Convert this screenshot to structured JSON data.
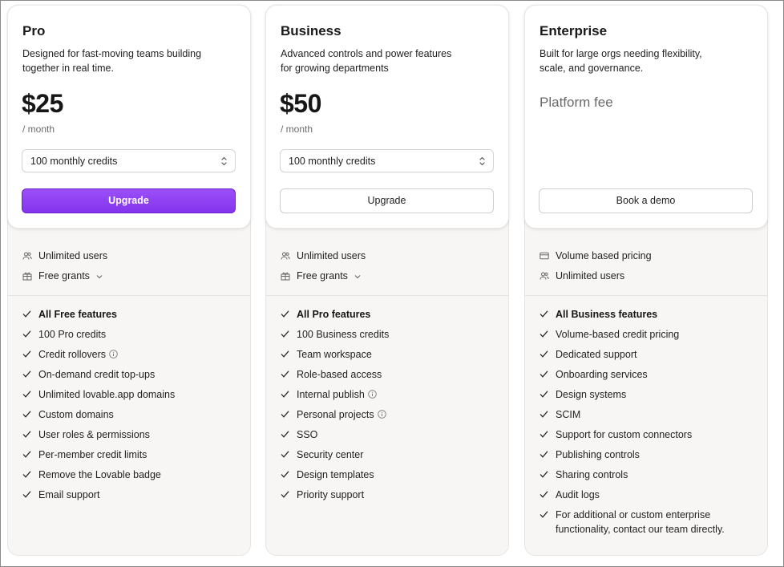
{
  "plans": [
    {
      "name": "Pro",
      "description": "Designed for fast-moving teams building together in real time.",
      "price": "$25",
      "period": "/ month",
      "credits_select": "100 monthly credits",
      "button": "Upgrade",
      "meta": [
        {
          "icon": "users-icon",
          "label": "Unlimited users"
        },
        {
          "icon": "gift-icon",
          "label": "Free grants"
        }
      ],
      "features": [
        {
          "label": "All Free features",
          "bold": true
        },
        {
          "label": "100 Pro credits"
        },
        {
          "label": "Credit rollovers",
          "info": true
        },
        {
          "label": "On-demand credit top-ups"
        },
        {
          "label": "Unlimited lovable.app domains"
        },
        {
          "label": "Custom domains"
        },
        {
          "label": "User roles & permissions"
        },
        {
          "label": "Per-member credit limits"
        },
        {
          "label": "Remove the Lovable badge"
        },
        {
          "label": "Email support"
        }
      ]
    },
    {
      "name": "Business",
      "description": "Advanced controls and power features for growing departments",
      "price": "$50",
      "period": "/ month",
      "credits_select": "100 monthly credits",
      "button": "Upgrade",
      "meta": [
        {
          "icon": "users-icon",
          "label": "Unlimited users"
        },
        {
          "icon": "gift-icon",
          "label": "Free grants"
        }
      ],
      "features": [
        {
          "label": "All Pro features",
          "bold": true
        },
        {
          "label": "100 Business credits"
        },
        {
          "label": "Team workspace"
        },
        {
          "label": "Role-based access"
        },
        {
          "label": "Internal publish",
          "info": true
        },
        {
          "label": "Personal projects",
          "info": true
        },
        {
          "label": "SSO"
        },
        {
          "label": "Security center"
        },
        {
          "label": "Design templates"
        },
        {
          "label": "Priority support"
        }
      ]
    },
    {
      "name": "Enterprise",
      "description": "Built for large orgs needing flexibility, scale, and governance.",
      "platform_fee": "Platform fee",
      "button": "Book a demo",
      "meta": [
        {
          "icon": "credit-card-icon",
          "label": "Volume based pricing"
        },
        {
          "icon": "users-icon",
          "label": "Unlimited users"
        }
      ],
      "features": [
        {
          "label": "All Business features",
          "bold": true
        },
        {
          "label": "Volume-based credit pricing"
        },
        {
          "label": "Dedicated support"
        },
        {
          "label": "Onboarding services"
        },
        {
          "label": "Design systems"
        },
        {
          "label": "SCIM"
        },
        {
          "label": "Support for custom connectors"
        },
        {
          "label": "Publishing controls"
        },
        {
          "label": "Sharing controls"
        },
        {
          "label": "Audit logs"
        },
        {
          "label": "For additional or custom enterprise functionality, contact our team directly."
        }
      ]
    }
  ],
  "colors": {
    "accent": "#8434ee",
    "card_bottom": "#f7f6f4",
    "text": "#222222",
    "muted": "#6b6b6b"
  }
}
